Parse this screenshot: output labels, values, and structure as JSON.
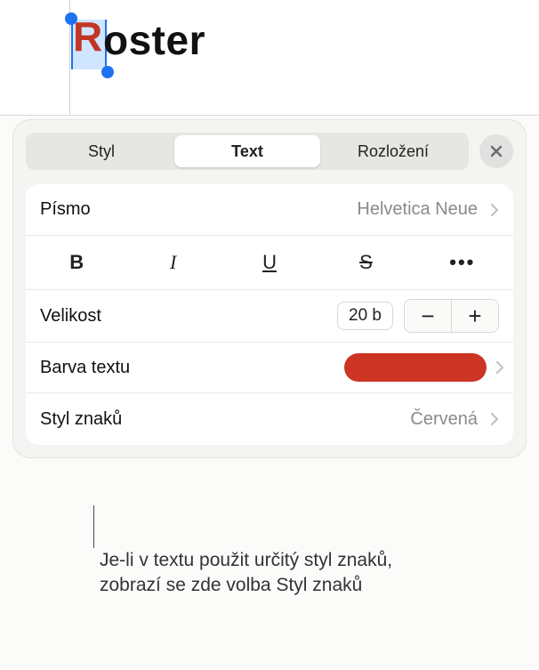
{
  "document": {
    "title_rest": "oster",
    "selected_char": "R"
  },
  "tabs": {
    "items": [
      "Styl",
      "Text",
      "Rozložení"
    ],
    "active_index": 1
  },
  "font": {
    "label": "Písmo",
    "value": "Helvetica Neue"
  },
  "format_buttons": {
    "bold": "B",
    "italic": "I",
    "underline": "U",
    "strike": "S",
    "more": "•••"
  },
  "size": {
    "label": "Velikost",
    "value": "20 b",
    "minus": "−",
    "plus": "+"
  },
  "text_color": {
    "label": "Barva textu",
    "value_hex": "#cc3524"
  },
  "char_style": {
    "label": "Styl znaků",
    "value": "Červená"
  },
  "callout": {
    "text": "Je-li v textu použit určitý styl znaků, zobrazí se zde volba Styl znaků"
  }
}
